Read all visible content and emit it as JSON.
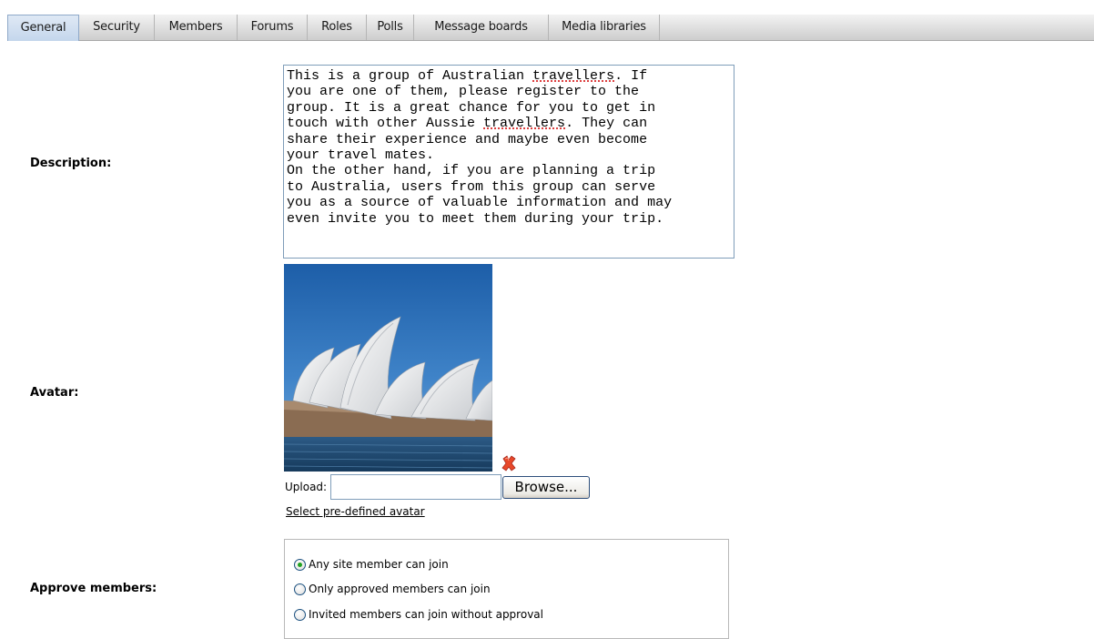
{
  "tabs": [
    "General",
    "Security",
    "Members",
    "Forums",
    "Roles",
    "Polls",
    "Message boards",
    "Media libraries"
  ],
  "active_tab": "General",
  "description": {
    "label": "Description:",
    "lines": [
      "This is a group of Australian travellers. If",
      "you are one of them, please register to the",
      "group. It is a great chance for you to get in",
      "touch with other Aussie travellers. They can",
      "share their experience and maybe even become",
      "your travel mates.",
      "On the other hand, if you are planning a trip",
      "to Australia, users from this group can serve",
      "you as a source of valuable information and may",
      "even invite you to meet them during your trip."
    ],
    "misspelled_word": "travellers"
  },
  "avatar": {
    "label": "Avatar:",
    "upload_label": "Upload:",
    "upload_value": "",
    "browse_label": "Browse...",
    "select_link": "Select pre-defined avatar",
    "delete_icon": "delete-x-icon"
  },
  "approve": {
    "label": "Approve members:",
    "options": [
      {
        "label": "Any site member can join",
        "checked": true
      },
      {
        "label": "Only approved members can join",
        "checked": false
      },
      {
        "label": "Invited members can join without approval",
        "checked": false
      }
    ]
  },
  "colors": {
    "radio_dot": "#21a121",
    "delete_icon": "#e8482a",
    "input_border": "#7f9db9"
  }
}
